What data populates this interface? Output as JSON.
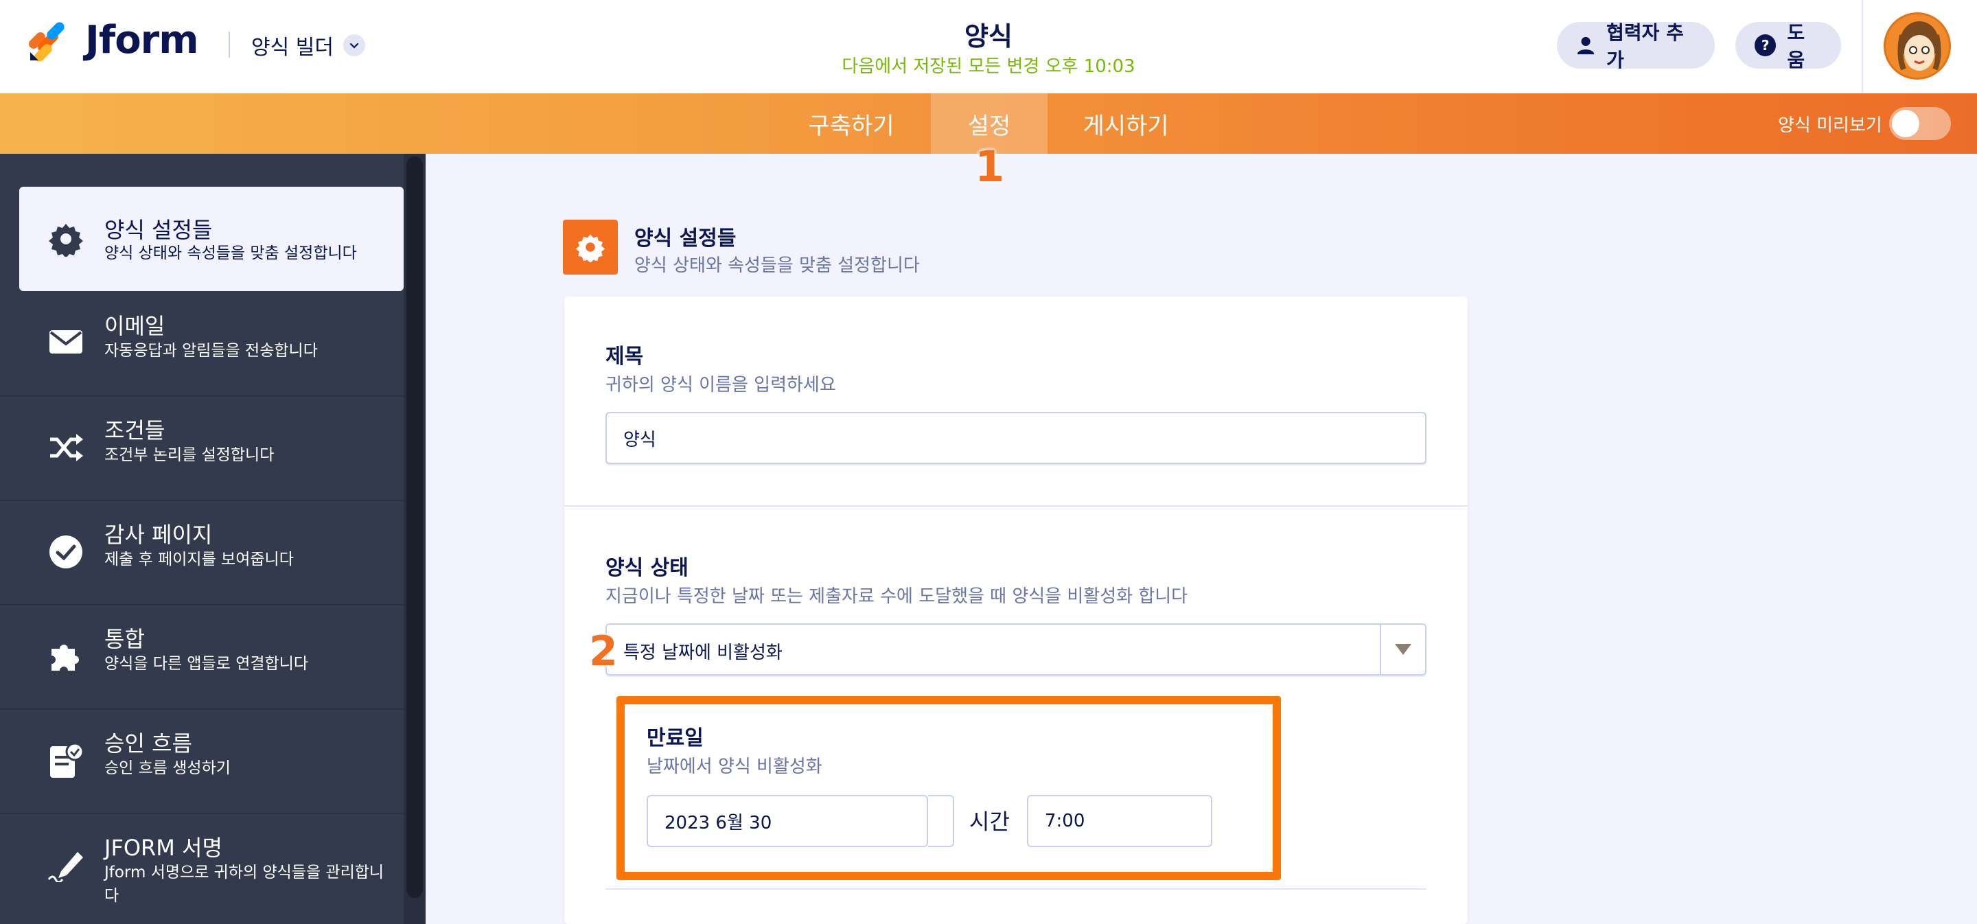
{
  "header": {
    "brand": "Jform",
    "builder_label": "양식 빌더",
    "form_title": "양식",
    "saved_status": "다음에서 저장된 모든 변경 오후 10:03",
    "add_collaborator": "협력자 추가",
    "help": "도움"
  },
  "nav": {
    "tabs": [
      {
        "label": "구축하기"
      },
      {
        "label": "설정"
      },
      {
        "label": "게시하기"
      }
    ],
    "preview_label": "양식 미리보기",
    "preview_on": false
  },
  "markers": {
    "one": "1",
    "two": "2"
  },
  "sidebar": {
    "items": [
      {
        "title": "양식 설정들",
        "desc": "양식 상태와 속성들을 맞춤 설정합니다",
        "icon": "gear-icon"
      },
      {
        "title": "이메일",
        "desc": "자동응답과 알림들을 전송합니다",
        "icon": "envelope-icon"
      },
      {
        "title": "조건들",
        "desc": "조건부 논리를 설정합니다",
        "icon": "shuffle-icon"
      },
      {
        "title": "감사 페이지",
        "desc": "제출 후 페이지를 보여줍니다",
        "icon": "check-circle-icon"
      },
      {
        "title": "통합",
        "desc": "양식을 다른 앱들로 연결합니다",
        "icon": "puzzle-icon"
      },
      {
        "title": "승인 흐름",
        "desc": "승인 흐름 생성하기",
        "icon": "approval-icon"
      },
      {
        "title": "JFORM 서명",
        "desc": "Jform 서명으로 귀하의 양식들을 관리합니다",
        "icon": "pen-signature-icon"
      }
    ]
  },
  "main": {
    "section_title": "양식 설정들",
    "section_desc": "양식 상태와 속성들을 맞춤 설정합니다",
    "title_field": {
      "label": "제목",
      "desc": "귀하의 양식 이름을 입력하세요",
      "value": "양식"
    },
    "status_field": {
      "label": "양식 상태",
      "desc": "지금이나 특정한 날짜 또는 제출자료 수에 도달했을 때 양식을 비활성화 합니다",
      "selected": "특정 날짜에 비활성화"
    },
    "expiry": {
      "label": "만료일",
      "desc": "날짜에서 양식 비활성화",
      "date_value": "2023 6월 30",
      "time_label": "시간",
      "time_value": "7:00"
    }
  },
  "colors": {
    "accent_orange": "#f37021",
    "saved_green": "#78bb07",
    "navy": "#0a1551",
    "highlight": "#f97709"
  }
}
